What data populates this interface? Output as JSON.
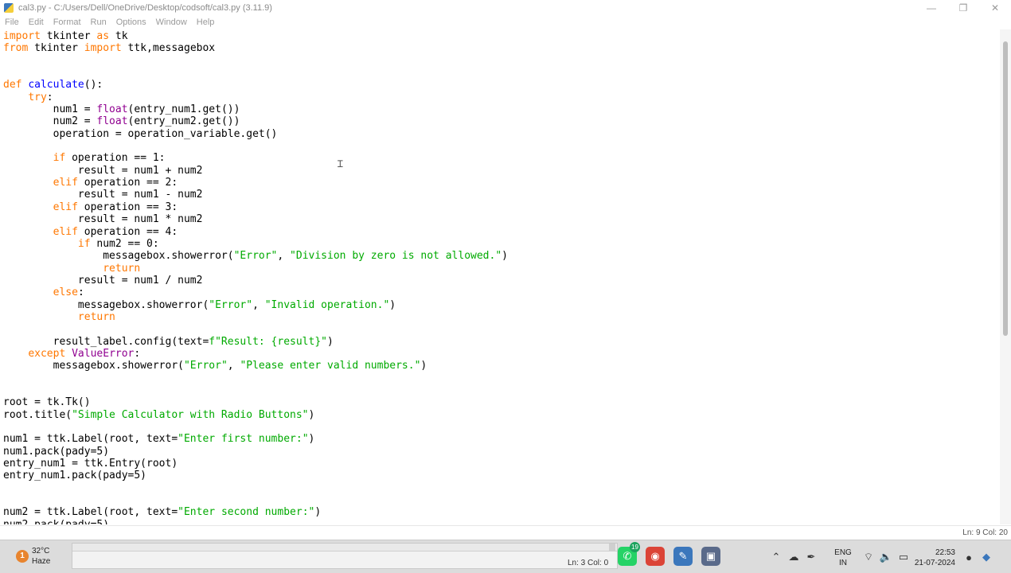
{
  "window": {
    "title": "cal3.py - C:/Users/Dell/OneDrive/Desktop/codsoft/cal3.py (3.11.9)",
    "controls": {
      "minimize": "—",
      "restore": "❐",
      "close": "✕"
    }
  },
  "menu": {
    "items": [
      "File",
      "Edit",
      "Format",
      "Run",
      "Options",
      "Window",
      "Help"
    ]
  },
  "editor": {
    "code_lines": [
      [
        {
          "t": "import",
          "c": "kw"
        },
        {
          "t": " tkinter "
        },
        {
          "t": "as",
          "c": "kw"
        },
        {
          "t": " tk"
        }
      ],
      [
        {
          "t": "from",
          "c": "kw"
        },
        {
          "t": " tkinter "
        },
        {
          "t": "import",
          "c": "kw"
        },
        {
          "t": " ttk,messagebox"
        }
      ],
      [],
      [],
      [
        {
          "t": "def",
          "c": "kw"
        },
        {
          "t": " "
        },
        {
          "t": "calculate",
          "c": "fn"
        },
        {
          "t": "():"
        }
      ],
      [
        {
          "t": "    "
        },
        {
          "t": "try",
          "c": "kw"
        },
        {
          "t": ":"
        }
      ],
      [
        {
          "t": "        num1 = "
        },
        {
          "t": "float",
          "c": "bi"
        },
        {
          "t": "(entry_num1.get())"
        }
      ],
      [
        {
          "t": "        num2 = "
        },
        {
          "t": "float",
          "c": "bi"
        },
        {
          "t": "(entry_num2.get())"
        }
      ],
      [
        {
          "t": "        operation = operation_variable.get()"
        }
      ],
      [],
      [
        {
          "t": "        "
        },
        {
          "t": "if",
          "c": "kw"
        },
        {
          "t": " operation == 1:"
        }
      ],
      [
        {
          "t": "            result = num1 + num2"
        }
      ],
      [
        {
          "t": "        "
        },
        {
          "t": "elif",
          "c": "kw"
        },
        {
          "t": " operation == 2:"
        }
      ],
      [
        {
          "t": "            result = num1 - num2"
        }
      ],
      [
        {
          "t": "        "
        },
        {
          "t": "elif",
          "c": "kw"
        },
        {
          "t": " operation == 3:"
        }
      ],
      [
        {
          "t": "            result = num1 * num2"
        }
      ],
      [
        {
          "t": "        "
        },
        {
          "t": "elif",
          "c": "kw"
        },
        {
          "t": " operation == 4:"
        }
      ],
      [
        {
          "t": "            "
        },
        {
          "t": "if",
          "c": "kw"
        },
        {
          "t": " num2 == 0:"
        }
      ],
      [
        {
          "t": "                messagebox.showerror("
        },
        {
          "t": "\"Error\"",
          "c": "st"
        },
        {
          "t": ", "
        },
        {
          "t": "\"Division by zero is not allowed.\"",
          "c": "st"
        },
        {
          "t": ")"
        }
      ],
      [
        {
          "t": "                "
        },
        {
          "t": "return",
          "c": "kw"
        }
      ],
      [
        {
          "t": "            result = num1 / num2"
        }
      ],
      [
        {
          "t": "        "
        },
        {
          "t": "else",
          "c": "kw"
        },
        {
          "t": ":"
        }
      ],
      [
        {
          "t": "            messagebox.showerror("
        },
        {
          "t": "\"Error\"",
          "c": "st"
        },
        {
          "t": ", "
        },
        {
          "t": "\"Invalid operation.\"",
          "c": "st"
        },
        {
          "t": ")"
        }
      ],
      [
        {
          "t": "            "
        },
        {
          "t": "return",
          "c": "kw"
        }
      ],
      [],
      [
        {
          "t": "        result_label.config(text="
        },
        {
          "t": "f\"Result: {result}\"",
          "c": "st"
        },
        {
          "t": ")"
        }
      ],
      [
        {
          "t": "    "
        },
        {
          "t": "except",
          "c": "kw"
        },
        {
          "t": " "
        },
        {
          "t": "ValueError",
          "c": "bi"
        },
        {
          "t": ":"
        }
      ],
      [
        {
          "t": "        messagebox.showerror("
        },
        {
          "t": "\"Error\"",
          "c": "st"
        },
        {
          "t": ", "
        },
        {
          "t": "\"Please enter valid numbers.\"",
          "c": "st"
        },
        {
          "t": ")"
        }
      ],
      [],
      [],
      [
        {
          "t": "root = tk.Tk()"
        }
      ],
      [
        {
          "t": "root.title("
        },
        {
          "t": "\"Simple Calculator with Radio Buttons\"",
          "c": "st"
        },
        {
          "t": ")"
        }
      ],
      [],
      [
        {
          "t": "num1 = ttk.Label(root, text="
        },
        {
          "t": "\"Enter first number:\"",
          "c": "st"
        },
        {
          "t": ")"
        }
      ],
      [
        {
          "t": "num1.pack(pady=5)"
        }
      ],
      [
        {
          "t": "entry_num1 = ttk.Entry(root)"
        }
      ],
      [
        {
          "t": "entry_num1.pack(pady=5)"
        }
      ],
      [],
      [],
      [
        {
          "t": "num2 = ttk.Label(root, text="
        },
        {
          "t": "\"Enter second number:\"",
          "c": "st"
        },
        {
          "t": ")"
        }
      ],
      [
        {
          "t": "num2.pack(pady=5)"
        }
      ]
    ]
  },
  "status": {
    "position": "Ln: 9   Col: 20"
  },
  "taskbar": {
    "weather": {
      "temp": "32°C",
      "condition": "Haze",
      "icon": "weather-sun-icon",
      "badge": "1"
    },
    "ghost_window_status": "Ln: 3   Col: 0",
    "apps": [
      {
        "name": "whatsapp-icon",
        "glyph": "✆",
        "color": "#25d366",
        "badge": "19"
      },
      {
        "name": "chrome-icon",
        "glyph": "◉",
        "color": "#db4437"
      },
      {
        "name": "python-editor-icon",
        "glyph": "✎",
        "color": "#3b77bc"
      },
      {
        "name": "idle-window-icon",
        "glyph": "▣",
        "color": "#5a6a8a"
      }
    ],
    "tray": {
      "chevron": "⌃",
      "lang_top": "ENG",
      "lang_bottom": "IN",
      "time": "22:53",
      "date": "21-07-2024"
    }
  },
  "colors": {
    "keyword": "#ff7700",
    "builtin": "#900090",
    "definition": "#0000ff",
    "string": "#00aa00",
    "taskbar": "#dcdcdc"
  }
}
